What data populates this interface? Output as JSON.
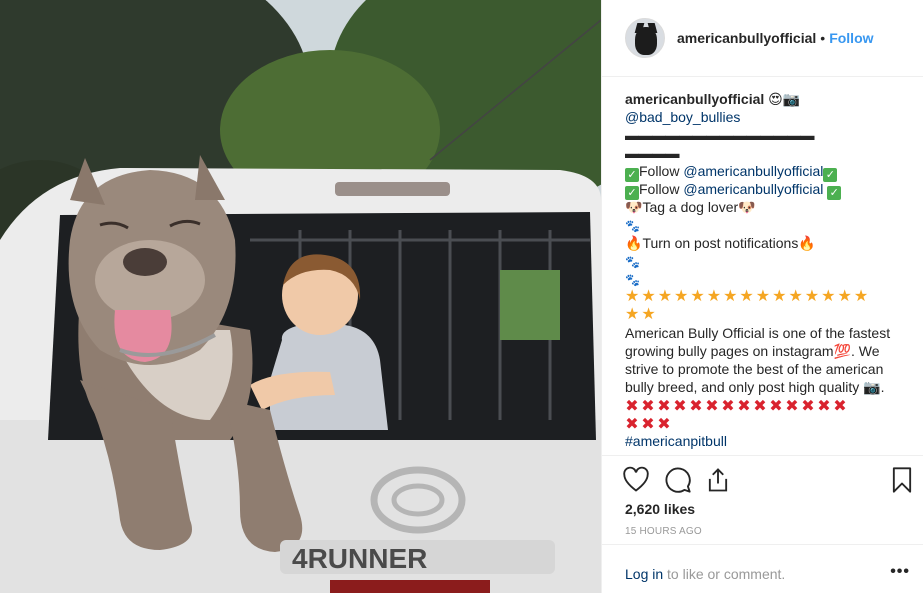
{
  "header": {
    "username": "americanbullyofficial",
    "separator": "•",
    "follow_label": "Follow"
  },
  "caption": {
    "username": "americanbullyofficial",
    "username_emojis": "😍📷",
    "tag": "@bad_boy_bullies",
    "dash_line_1": "▬▬▬▬▬▬▬▬▬▬▬▬▬▬",
    "dash_line_2": "▬▬▬▬",
    "follow_prefix": "Follow ",
    "follow_handle": "@americanbullyofficial",
    "tag_lover": "Tag a dog lover",
    "notifications": "Turn on post notifications",
    "description": "American Bully Official is one of the fastest growing bully pages on instagram💯. We strive to promote the best of the american bully breed, and only post high quality 📷.",
    "hashtag": "#americanpitbull"
  },
  "icons": {
    "dog": "🐶",
    "paw": "🐾",
    "fire": "🔥",
    "check": "✓",
    "star": "★",
    "cross": "✖"
  },
  "actions": {
    "likes": "2,620 likes",
    "time_ago": "15 HOURS AGO",
    "login_link": "Log in",
    "login_rest": " to like or comment.",
    "more": "•••"
  },
  "colors": {
    "link_blue": "#3897f0",
    "link_dark": "#003569",
    "muted": "#999999",
    "text": "#262626"
  }
}
